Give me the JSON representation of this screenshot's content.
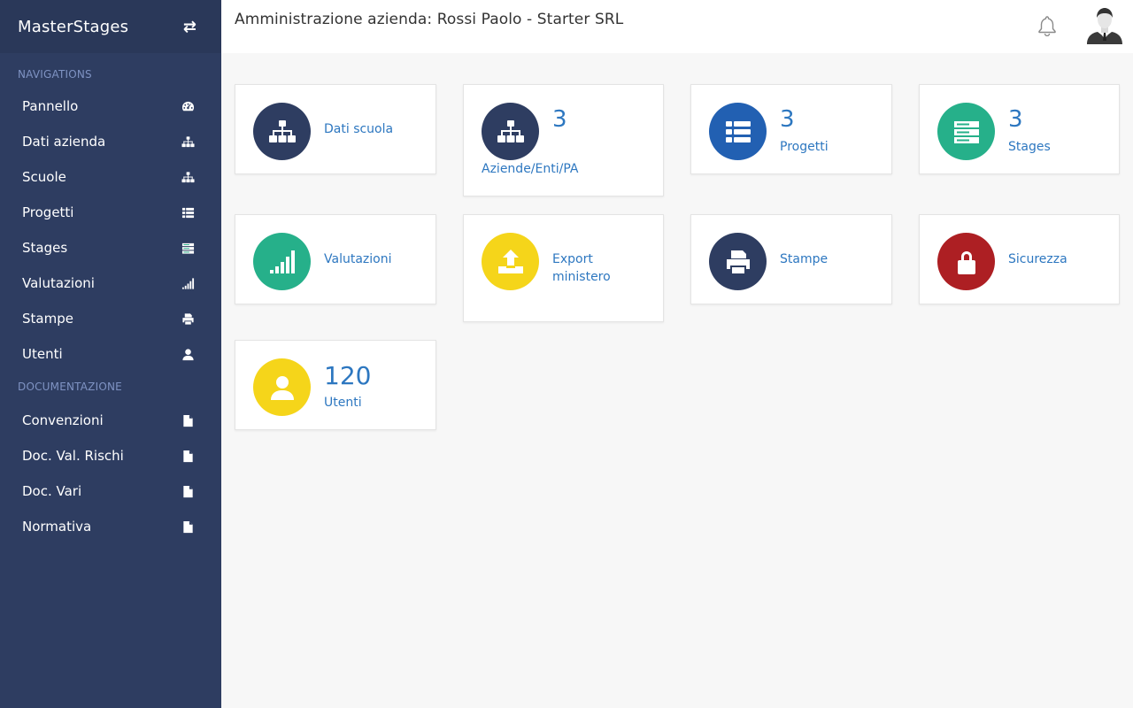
{
  "sidebar": {
    "brand": "MasterStages",
    "toggle_icon": "swap-arrows-icon",
    "section_nav": "NAVIGATIONS",
    "nav_items": [
      {
        "label": "Pannello",
        "icon": "dashboard-icon"
      },
      {
        "label": "Dati azienda",
        "icon": "sitemap-icon"
      },
      {
        "label": "Scuole",
        "icon": "sitemap-icon"
      },
      {
        "label": "Progetti",
        "icon": "list-icon"
      },
      {
        "label": "Stages",
        "icon": "server-icon"
      },
      {
        "label": "Valutazioni",
        "icon": "signal-icon"
      },
      {
        "label": "Stampe",
        "icon": "printer-icon"
      },
      {
        "label": "Utenti",
        "icon": "user-icon"
      }
    ],
    "section_doc": "DOCUMENTAZIONE",
    "doc_items": [
      {
        "label": "Convenzioni",
        "icon": "file-icon"
      },
      {
        "label": "Doc. Val. Rischi",
        "icon": "file-icon"
      },
      {
        "label": "Doc. Vari",
        "icon": "file-icon"
      },
      {
        "label": "Normativa",
        "icon": "file-icon"
      }
    ]
  },
  "header": {
    "title": "Amministrazione azienda: Rossi Paolo - Starter SRL",
    "notification_icon": "bell-icon",
    "avatar_icon": "user-avatar-icon"
  },
  "cards": [
    {
      "label": "Dati scuola",
      "count": "",
      "icon": "sitemap-icon",
      "color": "#2e3d61"
    },
    {
      "label": "Aziende/Enti/PA",
      "count": "3",
      "icon": "sitemap-icon",
      "color": "#2e3d61"
    },
    {
      "label": "Progetti",
      "count": "3",
      "icon": "list-icon",
      "color": "#2260b2"
    },
    {
      "label": "Stages",
      "count": "3",
      "icon": "server-icon",
      "color": "#26b08a"
    },
    {
      "label": "Valutazioni",
      "count": "",
      "icon": "signal-icon",
      "color": "#26b08a"
    },
    {
      "label_line1": "Export",
      "label_line2": "ministero",
      "count": "",
      "icon": "upload-icon",
      "color": "#f5d51a"
    },
    {
      "label": "Stampe",
      "count": "",
      "icon": "printer-icon",
      "color": "#2e3d61"
    },
    {
      "label": "Sicurezza",
      "count": "",
      "icon": "lock-icon",
      "color": "#ad1f23"
    },
    {
      "label": "Utenti",
      "count": "120",
      "icon": "user-icon",
      "color": "#f5d51a"
    }
  ],
  "colors": {
    "sidebar_bg": "#2e3d61",
    "accent_text": "#2d77c0",
    "section_heading": "#7f93c3"
  }
}
